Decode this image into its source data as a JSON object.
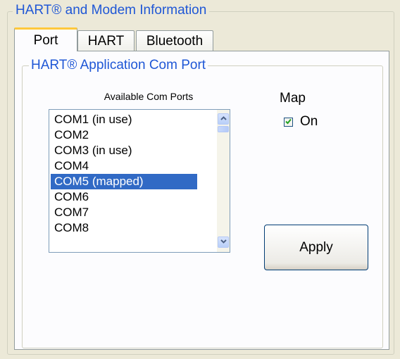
{
  "group_title": "HART® and Modem Information",
  "tabs": [
    {
      "label": "Port",
      "active": true
    },
    {
      "label": "HART",
      "active": false
    },
    {
      "label": "Bluetooth",
      "active": false
    }
  ],
  "port_panel": {
    "group_title": "HART® Application Com Port",
    "list_caption": "Available Com Ports",
    "com_ports": [
      {
        "label": "COM1 (in use)",
        "selected": false
      },
      {
        "label": "COM2",
        "selected": false
      },
      {
        "label": "COM3 (in use)",
        "selected": false
      },
      {
        "label": "COM4",
        "selected": false
      },
      {
        "label": "COM5 (mapped)",
        "selected": true
      },
      {
        "label": "COM6",
        "selected": false
      },
      {
        "label": "COM7",
        "selected": false
      },
      {
        "label": "COM8",
        "selected": false
      }
    ],
    "map_label": "Map",
    "map_checkbox": {
      "label": "On",
      "checked": true
    },
    "apply_label": "Apply"
  },
  "icons": {
    "scroll_up": "chevron-up-icon",
    "scroll_down": "chevron-down-icon",
    "checkmark": "check-icon"
  },
  "colors": {
    "legend_text": "#1f57d6",
    "selection": "#316ac5",
    "active_tab_highlight": "#ffc83c",
    "checkmark": "#21a121"
  }
}
